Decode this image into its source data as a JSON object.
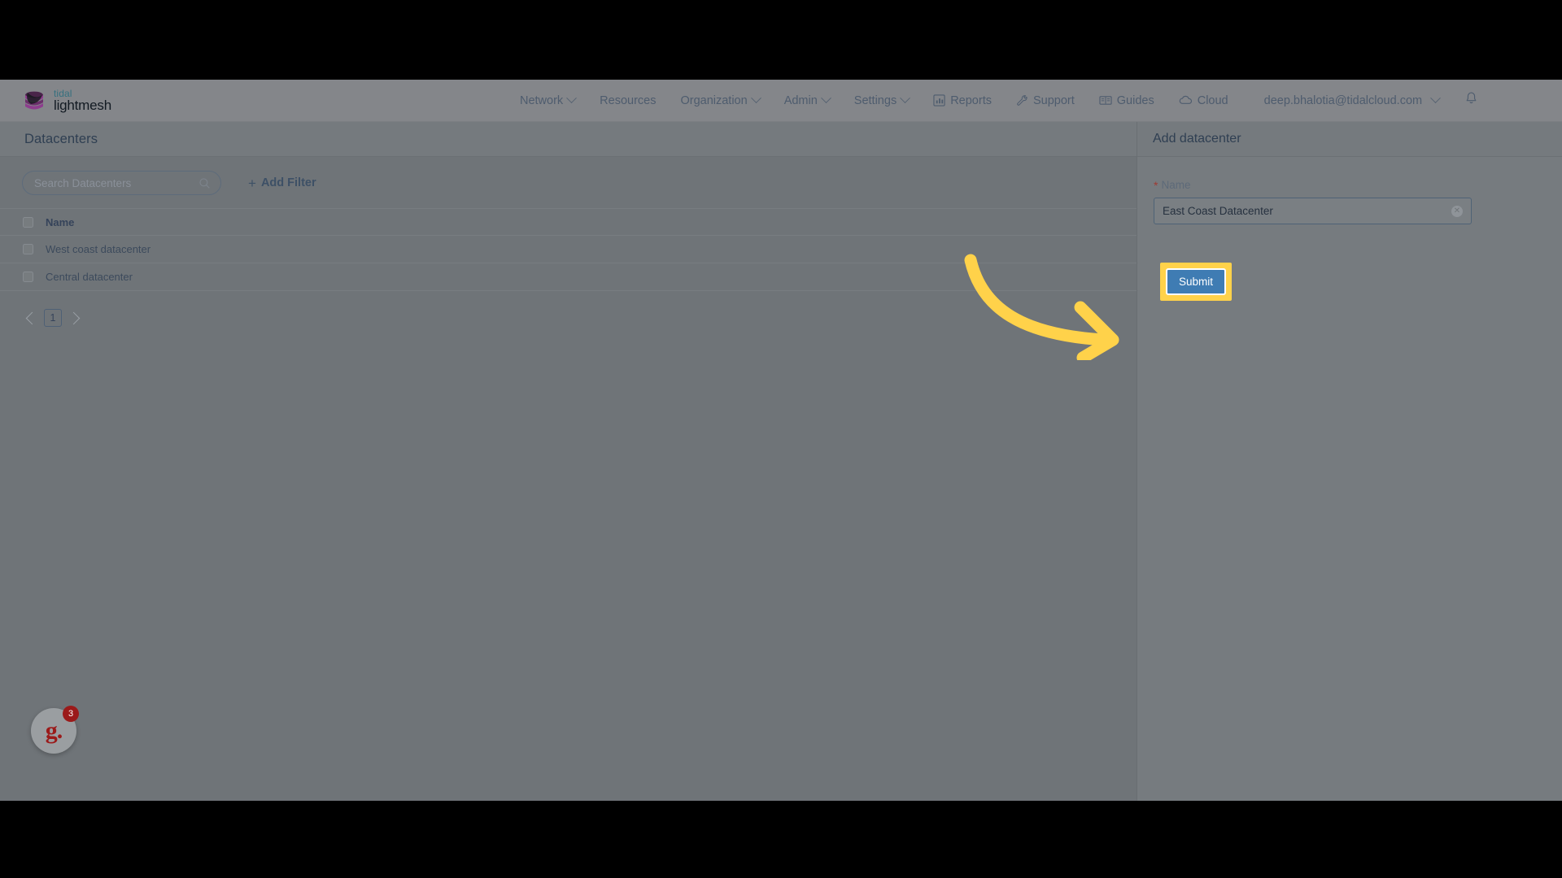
{
  "brand": {
    "name_top": "tidal",
    "name_bottom": "lightmesh",
    "logo_icon": "stacked-layers-icon",
    "accent_teal": "#35707f",
    "accent_purple": "#8e3d8e"
  },
  "navbar": {
    "items": [
      {
        "label": "Network",
        "has_chevron": true
      },
      {
        "label": "Resources",
        "has_chevron": false
      },
      {
        "label": "Organization",
        "has_chevron": true
      },
      {
        "label": "Admin",
        "has_chevron": true
      },
      {
        "label": "Settings",
        "has_chevron": true
      }
    ],
    "right_items": [
      {
        "label": "Reports",
        "icon": "bar-chart-icon"
      },
      {
        "label": "Support",
        "icon": "wrench-icon"
      },
      {
        "label": "Guides",
        "icon": "book-icon"
      },
      {
        "label": "Cloud",
        "icon": "cloud-icon"
      }
    ],
    "user_email": "deep.bhalotia@tidalcloud.com",
    "notification_icon": "bell-icon"
  },
  "page": {
    "title": "Datacenters"
  },
  "toolbar": {
    "search_placeholder": "Search Datacenters",
    "search_value": "",
    "search_icon": "magnifier-icon",
    "add_filter_label": "Add Filter",
    "add_filter_icon": "plus-icon"
  },
  "table": {
    "columns": [
      "Name"
    ],
    "rows": [
      {
        "name": "West coast datacenter"
      },
      {
        "name": "Central datacenter"
      }
    ]
  },
  "pagination": {
    "prev_icon": "chevron-left-icon",
    "next_icon": "chevron-right-icon",
    "current_page": "1"
  },
  "drawer": {
    "title": "Add datacenter",
    "name_label": "Name",
    "required_marker": "*",
    "name_value": "East Coast Datacenter",
    "clear_icon": "circle-x-icon",
    "submit_label": "Submit",
    "submit_color": "#3f7cb3",
    "highlight_color": "#ffd24a"
  },
  "annotation": {
    "arrow_icon": "curved-arrow-right-icon",
    "arrow_color": "#ffd24a"
  },
  "widget": {
    "label": "g.",
    "badge_count": "3",
    "badge_color": "#9b1a1a"
  }
}
